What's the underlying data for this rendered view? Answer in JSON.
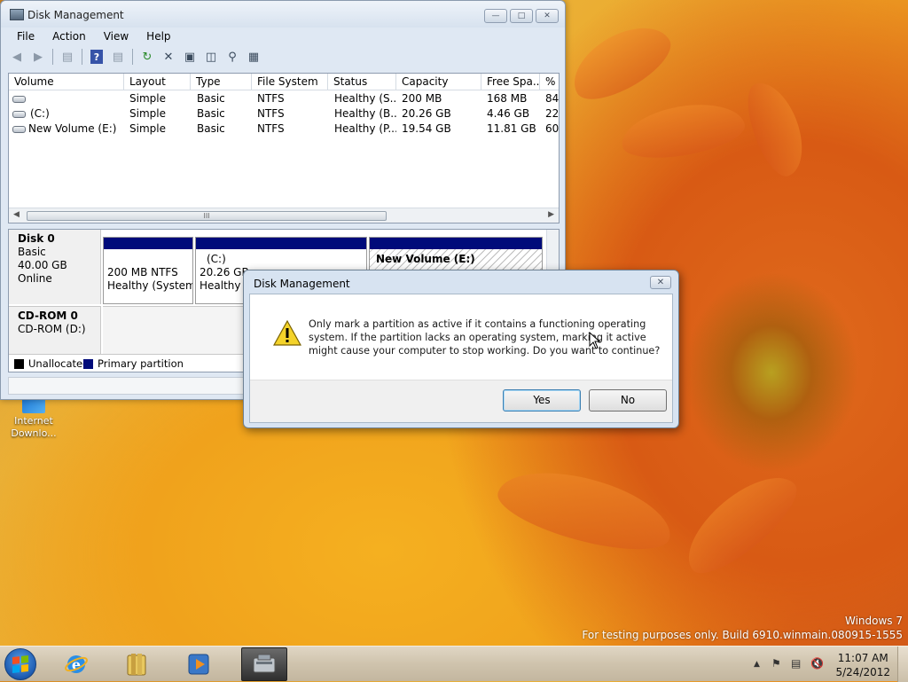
{
  "main_window": {
    "title": "Disk Management",
    "menu": [
      "File",
      "Action",
      "View",
      "Help"
    ],
    "volume_list": {
      "columns": [
        "Volume",
        "Layout",
        "Type",
        "File System",
        "Status",
        "Capacity",
        "Free Spa...",
        "% F"
      ],
      "rows": [
        [
          "",
          "Simple",
          "Basic",
          "NTFS",
          "Healthy (S...",
          "200 MB",
          "168 MB",
          "84"
        ],
        [
          "(C:)",
          "Simple",
          "Basic",
          "NTFS",
          "Healthy (B...",
          "20.26 GB",
          "4.46 GB",
          "22"
        ],
        [
          "New Volume (E:)",
          "Simple",
          "Basic",
          "NTFS",
          "Healthy (P...",
          "19.54 GB",
          "11.81 GB",
          "60"
        ]
      ],
      "scroll_grip": "III"
    },
    "disks": [
      {
        "name": "Disk 0",
        "lines": [
          "Basic",
          "40.00 GB",
          "Online"
        ],
        "partitions": [
          {
            "title": "",
            "size": "200 MB NTFS",
            "status": "Healthy (System,"
          },
          {
            "title": "(C:)",
            "size": "20.26 GB",
            "status": "Healthy ("
          },
          {
            "title": "New Volume  (E:)",
            "size": "",
            "status": ""
          }
        ]
      },
      {
        "name": "CD-ROM 0",
        "lines": [
          "CD-ROM (D:)"
        ]
      }
    ],
    "legend": [
      {
        "label": "Unallocated",
        "color": "#000000"
      },
      {
        "label": "Primary partition",
        "color": "#000b7a"
      }
    ]
  },
  "dialog": {
    "title": "Disk Management",
    "message": "Only mark a partition as active if it contains a functioning operating system. If the partition lacks an operating system, marking it active might cause your computer to stop working. Do you want to continue?",
    "yes_label": "Yes",
    "no_label": "No",
    "icon": "warning-icon"
  },
  "desktop": {
    "icon_label": "Internet Downlo...",
    "watermark_line1": "Windows 7",
    "watermark_line2": "For testing purposes only. Build 6910.winmain.080915-1555"
  },
  "taskbar": {
    "pinned": [
      "internet-explorer-icon",
      "windows-explorer-icon",
      "media-player-icon",
      "disk-management-icon"
    ],
    "clock_time": "11:07 AM",
    "clock_date": "5/24/2012"
  },
  "colors": {
    "primary_partition": "#000b7a",
    "title_bar": "#d7e2ef"
  }
}
